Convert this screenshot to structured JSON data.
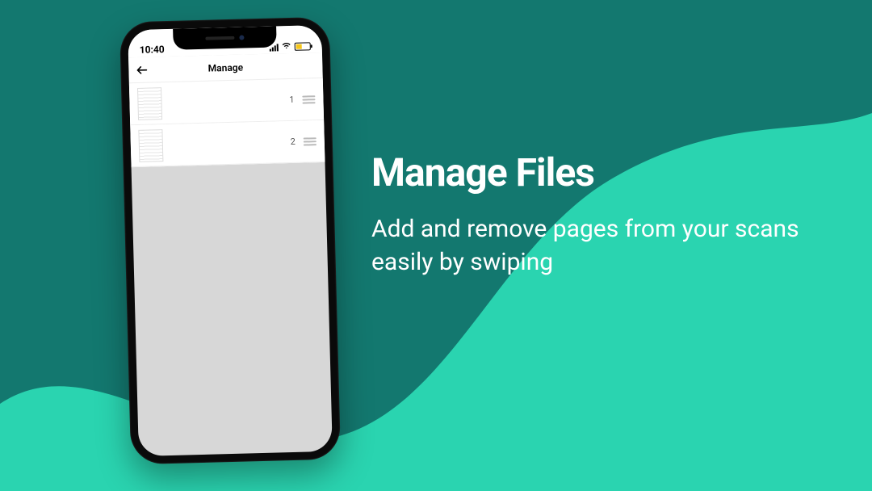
{
  "marketing": {
    "headline": "Manage Files",
    "subhead": "Add and remove pages from your scans easily by swiping"
  },
  "phone": {
    "status": {
      "time": "10:40"
    },
    "nav": {
      "title": "Manage"
    },
    "rows": [
      {
        "index": "1"
      },
      {
        "index": "2"
      }
    ]
  },
  "colors": {
    "bg_dark": "#13786f",
    "bg_light": "#2ad4b0",
    "text": "#ffffff"
  }
}
